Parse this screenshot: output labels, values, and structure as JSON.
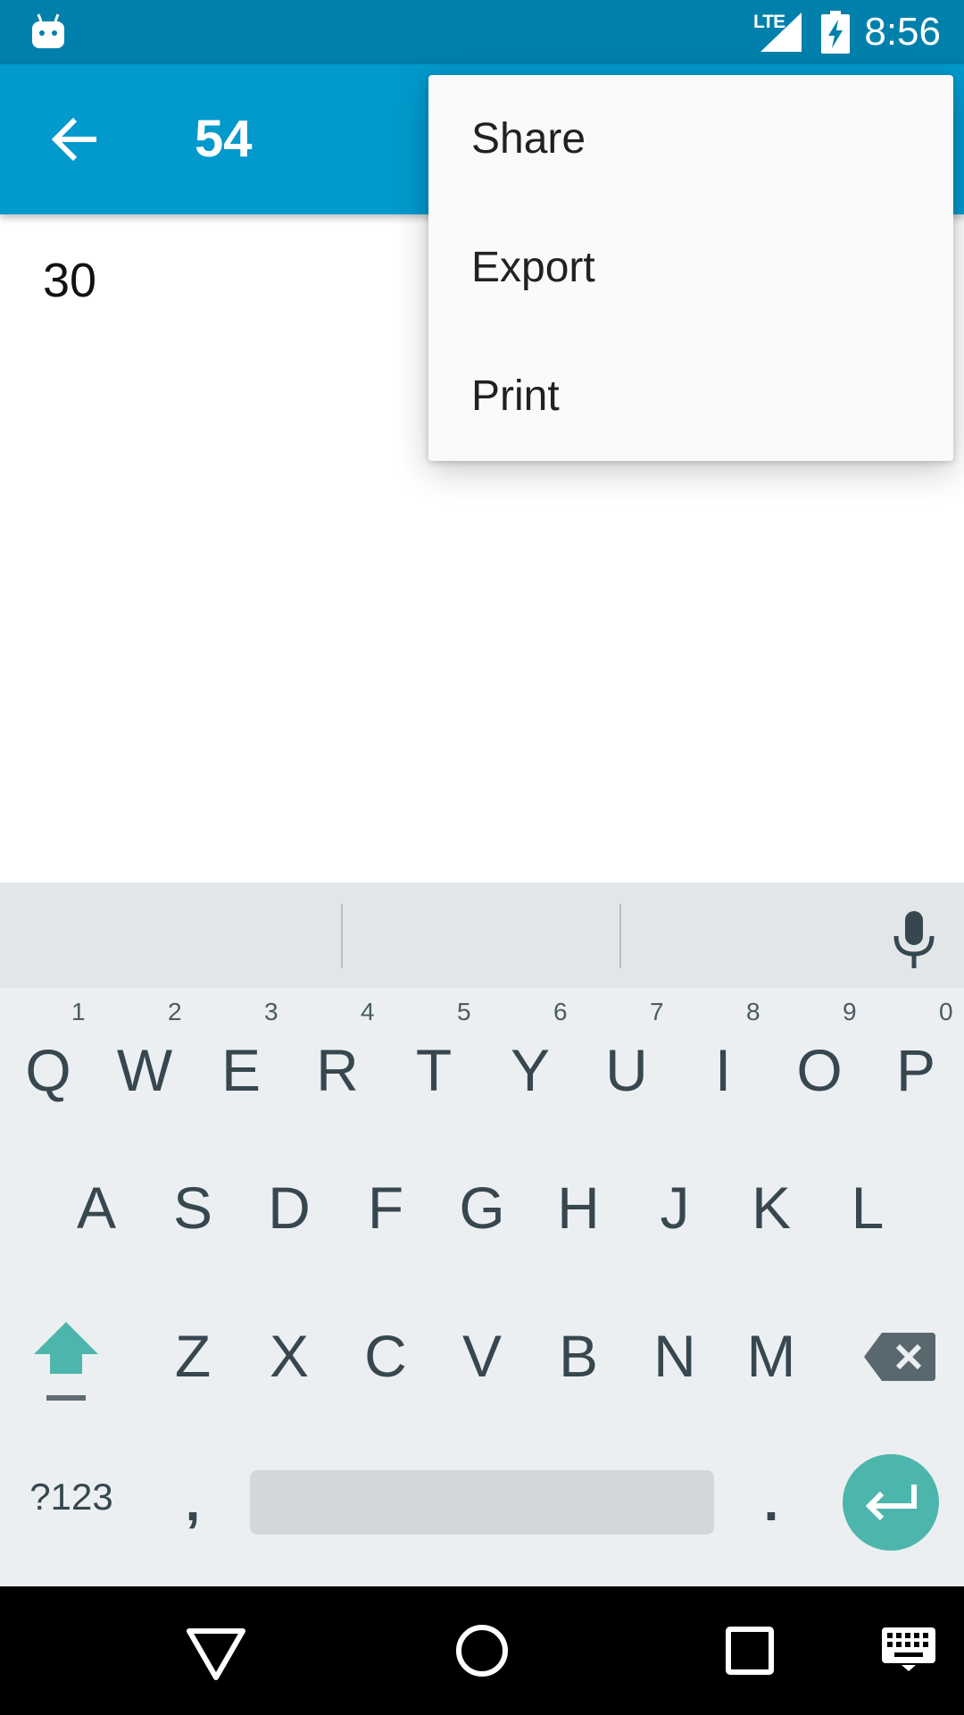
{
  "status_bar": {
    "time": "8:56",
    "network_label": "LTE",
    "icons": [
      "android-notification-icon",
      "signal-icon",
      "battery-charging-icon"
    ],
    "color": "#0180AB"
  },
  "app_bar": {
    "title": "54",
    "back_icon": "arrow-back-icon",
    "color": "#0299CC"
  },
  "content": {
    "text": "30"
  },
  "overflow_menu": {
    "items": [
      {
        "label": "Share"
      },
      {
        "label": "Export"
      },
      {
        "label": "Print"
      }
    ]
  },
  "keyboard": {
    "row1": [
      {
        "letter": "Q",
        "hint": "1"
      },
      {
        "letter": "W",
        "hint": "2"
      },
      {
        "letter": "E",
        "hint": "3"
      },
      {
        "letter": "R",
        "hint": "4"
      },
      {
        "letter": "T",
        "hint": "5"
      },
      {
        "letter": "Y",
        "hint": "6"
      },
      {
        "letter": "U",
        "hint": "7"
      },
      {
        "letter": "I",
        "hint": "8"
      },
      {
        "letter": "O",
        "hint": "9"
      },
      {
        "letter": "P",
        "hint": "0"
      }
    ],
    "row2": [
      "A",
      "S",
      "D",
      "F",
      "G",
      "H",
      "J",
      "K",
      "L"
    ],
    "row3": [
      "Z",
      "X",
      "C",
      "V",
      "B",
      "N",
      "M"
    ],
    "symbols_label": "?123",
    "comma": ",",
    "period": ".",
    "accent_color": "#4DB6AC"
  },
  "nav_bar": {
    "icons": [
      "back-triangle-icon",
      "home-circle-icon",
      "recents-square-icon",
      "keyboard-switch-icon"
    ]
  }
}
